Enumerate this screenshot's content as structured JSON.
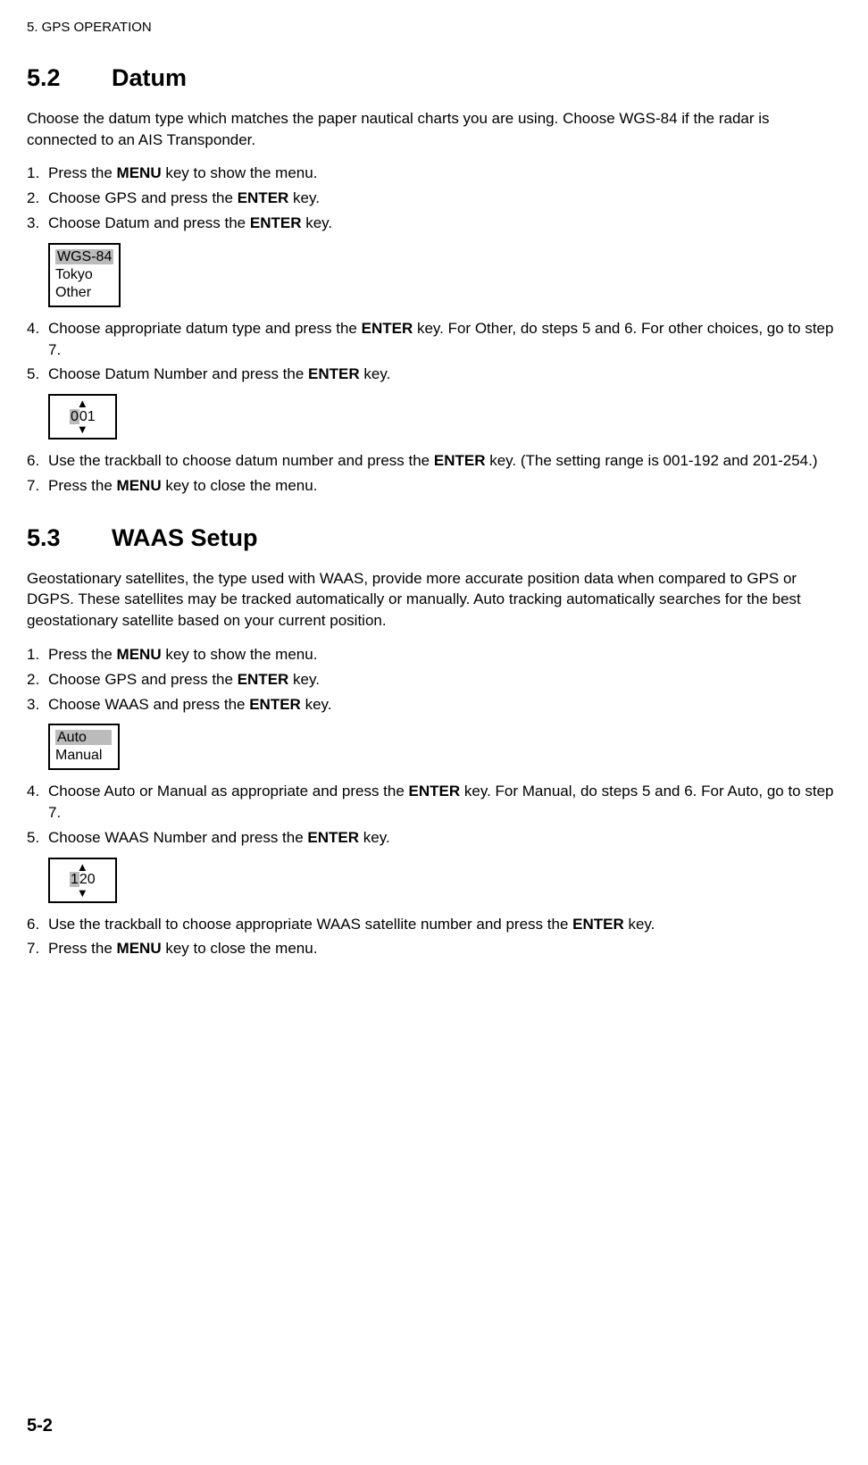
{
  "header": "5. GPS OPERATION",
  "s52": {
    "num": "5.2",
    "title": "Datum",
    "intro": "Choose the datum type which matches the paper nautical charts you are using. Choose WGS-84 if the radar is connected to an AIS Transponder.",
    "step1_a": "Press the ",
    "step1_b": "MENU",
    "step1_c": " key to show the menu.",
    "step2_a": "Choose GPS and press the ",
    "step2_b": "ENTER",
    "step2_c": " key.",
    "step3_a": "Choose Datum and press the ",
    "step3_b": "ENTER",
    "step3_c": " key.",
    "datum_box": {
      "opt1": "WGS-84",
      "opt2": "Tokyo",
      "opt3": "Other"
    },
    "step4_a": "Choose appropriate datum type and press the ",
    "step4_b": "ENTER",
    "step4_c": " key. For Other, do steps 5 and 6. For other choices, go to step 7.",
    "step5_a": "Choose Datum Number and press the ",
    "step5_b": "ENTER",
    "step5_c": " key.",
    "num_box": {
      "hl": "0",
      "rest": "01"
    },
    "step6_a": "Use the trackball to choose datum number and press the ",
    "step6_b": "ENTER",
    "step6_c": " key. (The setting range is 001-192 and 201-254.)",
    "step7_a": "Press the ",
    "step7_b": "MENU",
    "step7_c": " key to close the menu."
  },
  "s53": {
    "num": "5.3",
    "title": "WAAS Setup",
    "intro": "Geostationary satellites, the type used with WAAS, provide more accurate position data when compared to GPS or DGPS. These satellites may be tracked automatically or manually. Auto tracking automatically searches for the best geostationary satellite based on your current position.",
    "step1_a": "Press the ",
    "step1_b": "MENU",
    "step1_c": " key to show the menu.",
    "step2_a": "Choose GPS and press the ",
    "step2_b": "ENTER",
    "step2_c": " key.",
    "step3_a": "Choose WAAS and press the ",
    "step3_b": "ENTER",
    "step3_c": " key.",
    "waas_box": {
      "opt1": "Auto",
      "opt2": "Manual"
    },
    "step4_a": "Choose Auto or Manual as appropriate and press the ",
    "step4_b": "ENTER",
    "step4_c": " key. For Manual, do steps 5 and 6. For Auto, go to step 7.",
    "step5_a": "Choose WAAS Number and press the ",
    "step5_b": "ENTER",
    "step5_c": " key.",
    "num_box": {
      "hl": "1",
      "rest": "20"
    },
    "step6_a": "Use the trackball to choose appropriate WAAS satellite number and press the ",
    "step6_b": "ENTER",
    "step6_c": " key.",
    "step7_a": "Press the ",
    "step7_b": "MENU",
    "step7_c": " key to close the menu."
  },
  "page_num": "5-2",
  "n1": "1.",
  "n2": "2.",
  "n3": "3.",
  "n4": "4.",
  "n5": "5.",
  "n6": "6.",
  "n7": "7."
}
